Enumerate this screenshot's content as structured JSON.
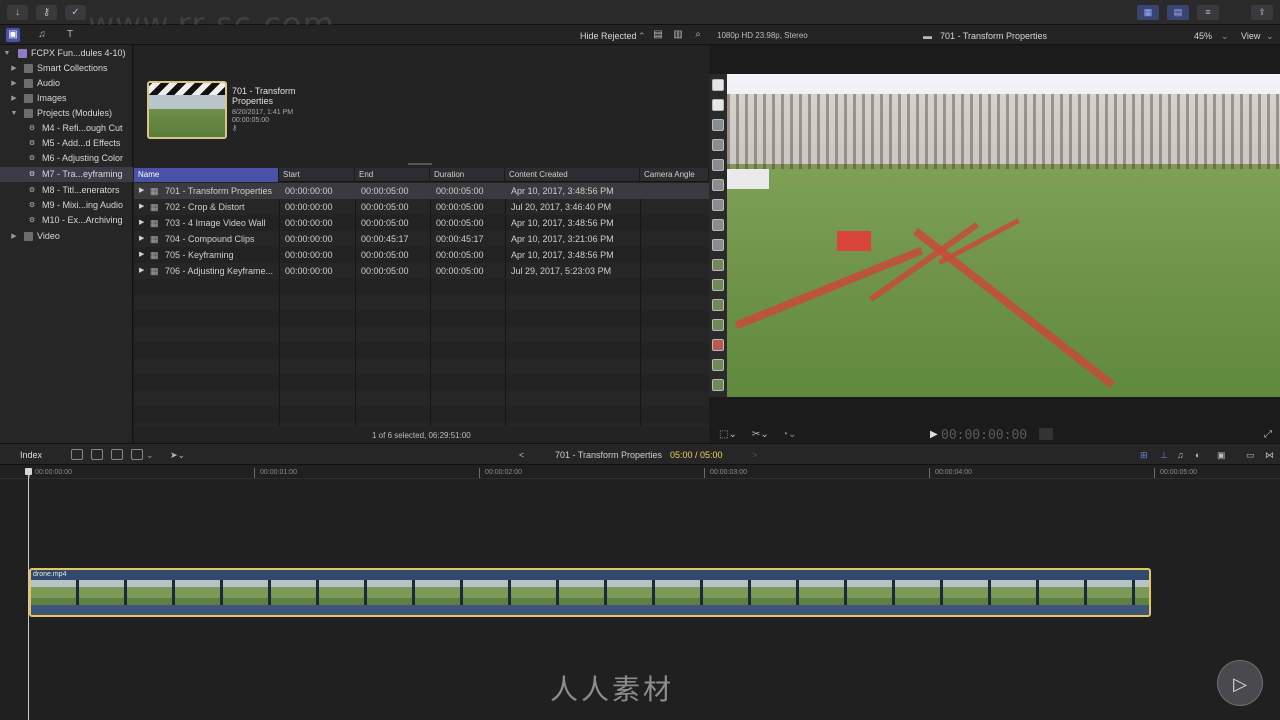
{
  "watermark": {
    "top_text": "www.rr-sc.com",
    "logo_text": "人人素材"
  },
  "browser_bar": {
    "filter": "Hide Rejected",
    "format": "1080p HD 23.98p, Stereo",
    "viewer_title": "701 - Transform Properties",
    "zoom": "45%",
    "view": "View"
  },
  "sidebar": {
    "library": "FCPX Fun...dules 4-10)",
    "items": [
      {
        "label": "Smart Collections"
      },
      {
        "label": "Audio"
      },
      {
        "label": "Images"
      },
      {
        "label": "Projects (Modules)"
      },
      {
        "label": "M4 - Refi...ough Cut"
      },
      {
        "label": "M5 - Add...d Effects"
      },
      {
        "label": "M6 - Adjusting Color"
      },
      {
        "label": "M7 - Tra...eyframing"
      },
      {
        "label": "M8 - Titl...enerators"
      },
      {
        "label": "M9 - Mixi...ing Audio"
      },
      {
        "label": "M10 - Ex...Archiving"
      },
      {
        "label": "Video"
      }
    ]
  },
  "browser": {
    "clip": {
      "title_line1": "701 - Transform",
      "title_line2": "Properties",
      "date": "8/20/2017, 1:41 PM",
      "duration": "00:00:05:00"
    },
    "columns": [
      "Name",
      "Start",
      "End",
      "Duration",
      "Content Created",
      "Camera Angle"
    ],
    "rows": [
      {
        "name": "701 - Transform Properties",
        "start": "00:00:00:00",
        "end": "00:00:05:00",
        "duration": "00:00:05:00",
        "created": "Apr 10, 2017, 3:48:56 PM"
      },
      {
        "name": "702 - Crop & Distort",
        "start": "00:00:00:00",
        "end": "00:00:05:00",
        "duration": "00:00:05:00",
        "created": "Jul 20, 2017, 3:46:40 PM"
      },
      {
        "name": "703 - 4 Image Video Wall",
        "start": "00:00:00:00",
        "end": "00:00:05:00",
        "duration": "00:00:05:00",
        "created": "Apr 10, 2017, 3:48:56 PM"
      },
      {
        "name": "704 - Compound Clips",
        "start": "00:00:00:00",
        "end": "00:00:45:17",
        "duration": "00:00:45:17",
        "created": "Apr 10, 2017, 3:21:06 PM"
      },
      {
        "name": "705 - Keyframing",
        "start": "00:00:00:00",
        "end": "00:00:05:00",
        "duration": "00:00:05:00",
        "created": "Apr 10, 2017, 3:48:56 PM"
      },
      {
        "name": "706 - Adjusting Keyframe...",
        "start": "00:00:00:00",
        "end": "00:00:05:00",
        "duration": "00:00:05:00",
        "created": "Jul 29, 2017, 5:23:03 PM"
      }
    ],
    "status": "1 of 6 selected, 06:29:51:00"
  },
  "viewer": {
    "timecode": "00:00:00:00"
  },
  "timeline_bar": {
    "index": "Index",
    "project": "701 - Transform Properties",
    "position": "05:00 / 05:00"
  },
  "timeline": {
    "ticks": [
      "00:00:00:00",
      "00:00:01:00",
      "00:00:02:00",
      "00:00:03:00",
      "00:00:04:00",
      "00:00:05:00"
    ],
    "clip_name": "drone.mp4"
  },
  "colors": {
    "accent": "#4a52a8",
    "clip_border": "#e5c55c",
    "position_highlight": "#f0d060"
  }
}
